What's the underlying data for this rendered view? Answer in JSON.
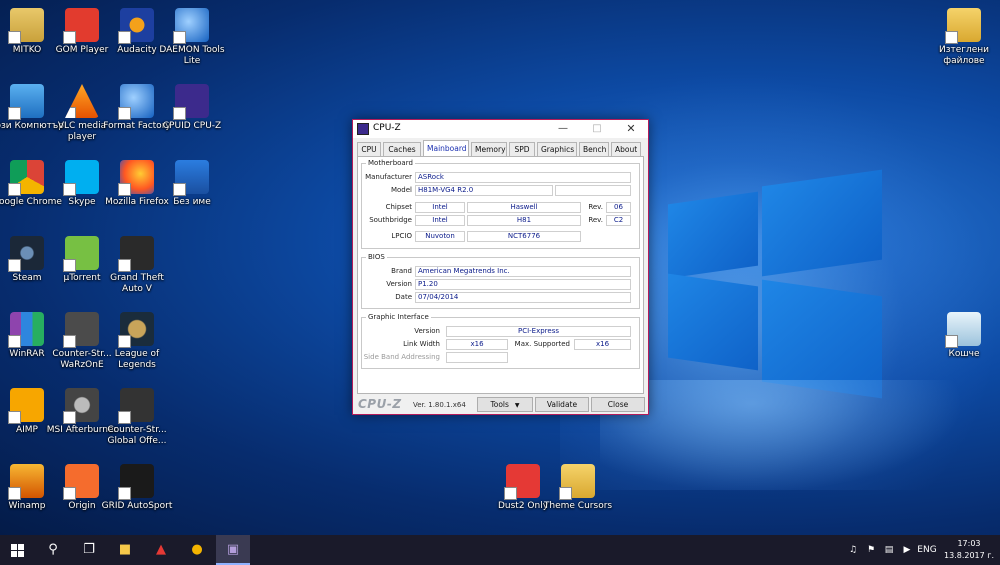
{
  "desktop": {
    "icons": [
      {
        "label": "MITKO",
        "icon": "user-folder-icon"
      },
      {
        "label": "GOM Player",
        "icon": "gom-player-icon"
      },
      {
        "label": "Audacity",
        "icon": "audacity-icon"
      },
      {
        "label": "DAEMON Tools Lite",
        "icon": "daemon-tools-icon"
      },
      {
        "label": "Този Компютър",
        "icon": "this-pc-icon"
      },
      {
        "label": "VLC media player",
        "icon": "vlc-icon"
      },
      {
        "label": "Format Factory",
        "icon": "format-factory-icon"
      },
      {
        "label": "CPUID CPU-Z",
        "icon": "cpuz-icon"
      },
      {
        "label": "Google Chrome",
        "icon": "chrome-icon"
      },
      {
        "label": "Skype",
        "icon": "skype-icon"
      },
      {
        "label": "Mozilla Firefox",
        "icon": "firefox-icon"
      },
      {
        "label": "Без име",
        "icon": "noname-icon"
      },
      {
        "label": "Steam",
        "icon": "steam-icon"
      },
      {
        "label": "µTorrent",
        "icon": "utorrent-icon"
      },
      {
        "label": "Grand Theft Auto V",
        "icon": "gta-icon"
      },
      {
        "label": "WinRAR",
        "icon": "winrar-icon"
      },
      {
        "label": "Counter-Str... WaRzOnE",
        "icon": "counter-strike-icon"
      },
      {
        "label": "League of Legends",
        "icon": "lol-icon"
      },
      {
        "label": "AIMP",
        "icon": "aimp-icon"
      },
      {
        "label": "MSI Afterburner",
        "icon": "msi-afterburner-icon"
      },
      {
        "label": "Counter-Str... Global Offe...",
        "icon": "csgo-icon"
      },
      {
        "label": "Winamp",
        "icon": "winamp-icon"
      },
      {
        "label": "Origin",
        "icon": "origin-icon"
      },
      {
        "label": "GRID AutoSport",
        "icon": "grid-icon"
      },
      {
        "label": "Изтеглени файлове",
        "icon": "downloads-folder-icon"
      },
      {
        "label": "Кошче",
        "icon": "recycle-bin-icon"
      },
      {
        "label": "Dust2 Only",
        "icon": "dust2-icon"
      },
      {
        "label": "Theme Cursors",
        "icon": "folder-icon"
      }
    ]
  },
  "cpuz": {
    "title": "CPU-Z",
    "tabs": [
      "CPU",
      "Caches",
      "Mainboard",
      "Memory",
      "SPD",
      "Graphics",
      "Bench",
      "About"
    ],
    "active_tab": "Mainboard",
    "motherboard": {
      "group_title": "Motherboard",
      "manufacturer_label": "Manufacturer",
      "manufacturer": "ASRock",
      "model_label": "Model",
      "model": "H81M-VG4 R2.0",
      "model_extra": "",
      "chipset_label": "Chipset",
      "chipset_vendor": "Intel",
      "chipset_name": "Haswell",
      "chipset_rev_label": "Rev.",
      "chipset_rev": "06",
      "southbridge_label": "Southbridge",
      "southbridge_vendor": "Intel",
      "southbridge_name": "H81",
      "southbridge_rev_label": "Rev.",
      "southbridge_rev": "C2",
      "lpcio_label": "LPCIO",
      "lpcio_vendor": "Nuvoton",
      "lpcio_name": "NCT6776"
    },
    "bios": {
      "group_title": "BIOS",
      "brand_label": "Brand",
      "brand": "American Megatrends Inc.",
      "version_label": "Version",
      "version": "P1.20",
      "date_label": "Date",
      "date": "07/04/2014"
    },
    "graphic_interface": {
      "group_title": "Graphic Interface",
      "version_label": "Version",
      "version": "PCI-Express",
      "link_width_label": "Link Width",
      "link_width": "x16",
      "max_supported_label": "Max. Supported",
      "max_supported": "x16",
      "side_band_label": "Side Band Addressing",
      "side_band": ""
    },
    "footer": {
      "brand": "CPU-Z",
      "version": "Ver. 1.80.1.x64",
      "tools_label": "Tools",
      "validate_label": "Validate",
      "close_label": "Close"
    }
  },
  "taskbar": {
    "language": "ENG",
    "time": "17:03",
    "date": "13.8.2017 г."
  }
}
